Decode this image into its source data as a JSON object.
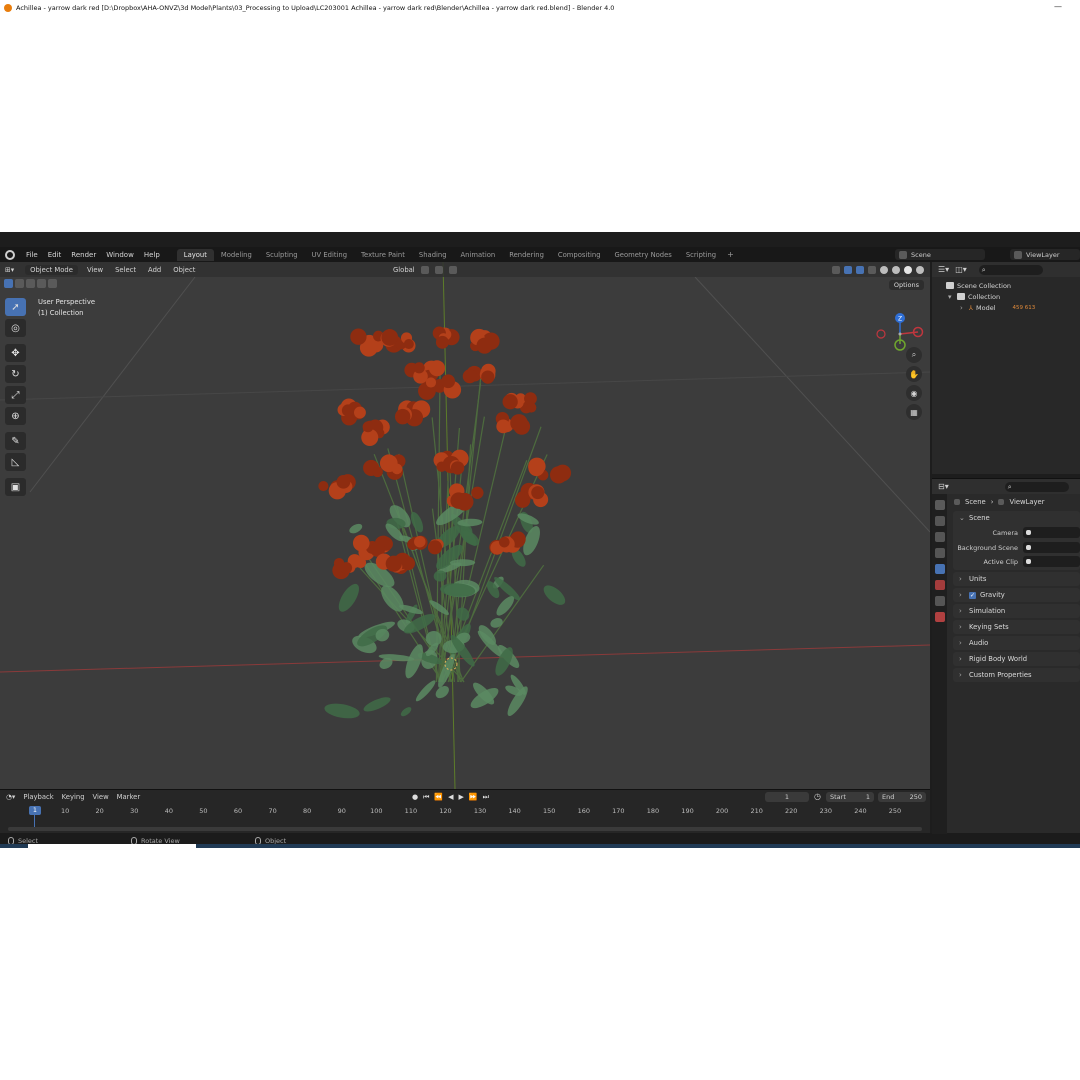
{
  "window": {
    "title": "Achillea - yarrow dark red [D:\\Dropbox\\AHA-ONVZ\\3d Model\\Plants\\03_Processing to Upload\\LC203001 Achillea - yarrow dark red\\Blender\\Achillea - yarrow dark red.blend] - Blender 4.0",
    "minimize": "—"
  },
  "menu": {
    "items": [
      "File",
      "Edit",
      "Render",
      "Window",
      "Help"
    ],
    "workspaces": [
      "Layout",
      "Modeling",
      "Sculpting",
      "UV Editing",
      "Texture Paint",
      "Shading",
      "Animation",
      "Rendering",
      "Compositing",
      "Geometry Nodes",
      "Scripting"
    ],
    "active_workspace": "Layout",
    "add_workspace": "+",
    "scene": "Scene",
    "view_layer": "ViewLayer"
  },
  "viewport": {
    "mode": "Object Mode",
    "menus": [
      "View",
      "Select",
      "Add",
      "Object"
    ],
    "orientation": "Global",
    "options": "Options",
    "perspective": "User Perspective",
    "collection_label": "(1) Collection",
    "gizmo_axes": {
      "z": "Z",
      "y": "Y",
      "x": "X"
    }
  },
  "timeline": {
    "menus": [
      "Playback",
      "Keying",
      "View",
      "Marker"
    ],
    "current_frame": "1",
    "start_label": "Start",
    "start_value": "1",
    "end_label": "End",
    "end_value": "250",
    "ticks": [
      "1",
      "10",
      "20",
      "30",
      "40",
      "50",
      "60",
      "70",
      "80",
      "90",
      "100",
      "110",
      "120",
      "130",
      "140",
      "150",
      "160",
      "170",
      "180",
      "190",
      "200",
      "210",
      "220",
      "230",
      "240",
      "250"
    ]
  },
  "status": {
    "select": "Select",
    "rotate": "Rotate View",
    "object": "Object"
  },
  "outliner": {
    "scene_collection": "Scene Collection",
    "collection": "Collection",
    "model": "Model",
    "model_badge": "459 613"
  },
  "properties": {
    "crumb_scene": "Scene",
    "crumb_viewlayer": "ViewLayer",
    "panel_scene": "Scene",
    "fields": [
      {
        "label": "Camera"
      },
      {
        "label": "Background Scene"
      },
      {
        "label": "Active Clip"
      }
    ],
    "panels": [
      "Units",
      "Gravity",
      "Simulation",
      "Keying Sets",
      "Audio",
      "Rigid Body World",
      "Custom Properties"
    ],
    "gravity_checked": "✓"
  },
  "colors": {
    "accent": "#4772b3",
    "flower": "#b4401a",
    "leaf": "#3f6b46",
    "axis_x": "#c0363e",
    "axis_y": "#6fa62e",
    "axis_z": "#2f6fd6"
  }
}
